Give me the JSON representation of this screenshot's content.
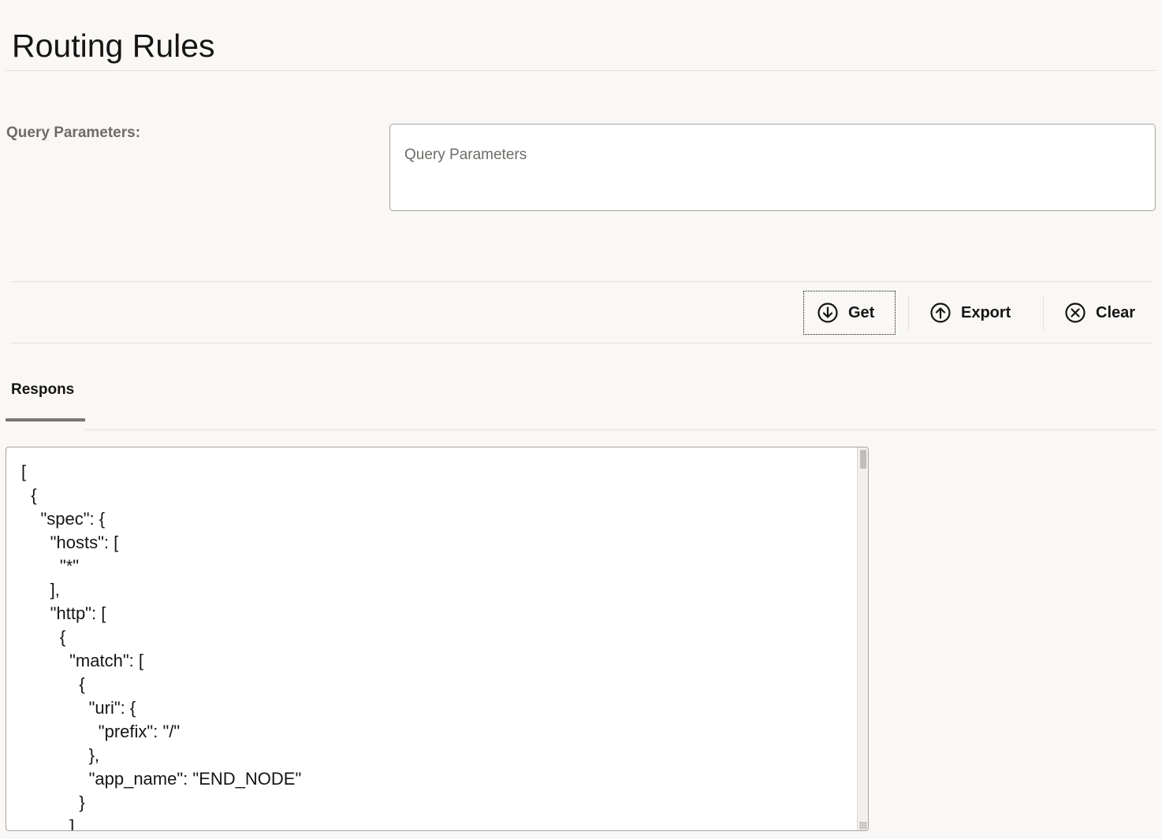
{
  "page": {
    "title": "Routing Rules"
  },
  "query": {
    "label": "Query Parameters:",
    "placeholder": "Query Parameters",
    "value": ""
  },
  "toolbar": {
    "get_label": "Get",
    "export_label": "Export",
    "clear_label": "Clear"
  },
  "tabs": [
    {
      "label": "Respons",
      "selected": true
    }
  ],
  "response": {
    "text": "[\n  {\n    \"spec\": {\n      \"hosts\": [\n        \"*\"\n      ],\n      \"http\": [\n        {\n          \"match\": [\n            {\n              \"uri\": {\n                \"prefix\": \"/\"\n              },\n              \"app_name\": \"END_NODE\"\n            }\n          ]"
  },
  "icons": {
    "get": "arrow-down-circle-icon",
    "export": "arrow-up-circle-icon",
    "clear": "x-circle-icon"
  }
}
